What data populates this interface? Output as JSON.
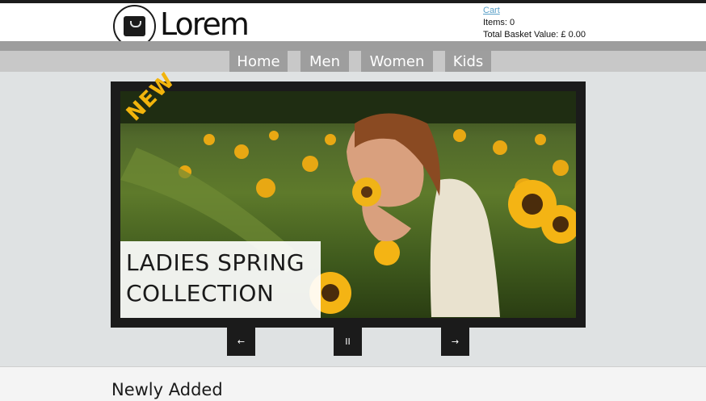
{
  "brand": {
    "name": "Lorem",
    "logo_icon": "shopping-bag-icon"
  },
  "cart": {
    "link_label": "Cart",
    "items_text": "Items: 0",
    "value_text": "Total Basket Value: £ 0.00",
    "link_color": "#5aa0c8"
  },
  "nav": {
    "tabs": [
      {
        "label": "Home"
      },
      {
        "label": "Men"
      },
      {
        "label": "Women"
      },
      {
        "label": "Kids"
      }
    ]
  },
  "slider": {
    "badge": "NEW",
    "badge_color": "#f2b40c",
    "caption_line1": "LADIES SPRING",
    "caption_line2": "COLLECTION",
    "controls": {
      "prev": "←",
      "pause": "II",
      "next": "→"
    }
  },
  "section": {
    "title": "Newly Added"
  },
  "colors": {
    "page_bg": "#dfe2e3",
    "nav_tab": "#9e9e9e",
    "frame": "#1b1b1b"
  }
}
